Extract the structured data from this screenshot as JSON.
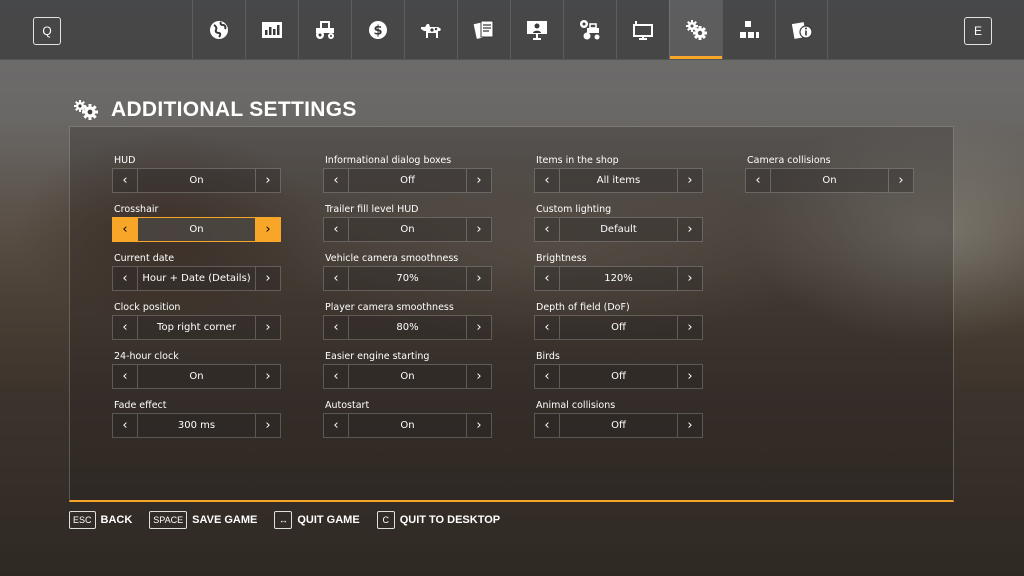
{
  "topbar": {
    "left_key": "Q",
    "right_key": "E",
    "tabs": [
      {
        "icon": "globe-icon"
      },
      {
        "icon": "statistics-icon"
      },
      {
        "icon": "tractor-icon"
      },
      {
        "icon": "money-icon"
      },
      {
        "icon": "cow-icon"
      },
      {
        "icon": "contracts-icon"
      },
      {
        "icon": "tutorial-icon"
      },
      {
        "icon": "vehicle-settings-icon"
      },
      {
        "icon": "monitor-icon"
      },
      {
        "icon": "gears-icon",
        "active": true
      },
      {
        "icon": "production-icon"
      },
      {
        "icon": "help-icon"
      }
    ],
    "accent_color": "#f7a627"
  },
  "page": {
    "title": "ADDITIONAL SETTINGS"
  },
  "columns": [
    [
      {
        "label": "HUD",
        "value": "On"
      },
      {
        "label": "Crosshair",
        "value": "On",
        "selected": true
      },
      {
        "label": "Current date",
        "value": "Hour + Date (Details)"
      },
      {
        "label": "Clock position",
        "value": "Top right corner"
      },
      {
        "label": "24-hour clock",
        "value": "On"
      },
      {
        "label": "Fade effect",
        "value": "300 ms"
      }
    ],
    [
      {
        "label": "Informational dialog boxes",
        "value": "Off"
      },
      {
        "label": "Trailer fill level HUD",
        "value": "On"
      },
      {
        "label": "Vehicle camera smoothness",
        "value": "70%"
      },
      {
        "label": "Player camera smoothness",
        "value": "80%"
      },
      {
        "label": "Easier engine starting",
        "value": "On"
      },
      {
        "label": "Autostart",
        "value": "On"
      }
    ],
    [
      {
        "label": "Items in the shop",
        "value": "All items"
      },
      {
        "label": "Custom lighting",
        "value": "Default"
      },
      {
        "label": "Brightness",
        "value": "120%"
      },
      {
        "label": "Depth of field (DoF)",
        "value": "Off"
      },
      {
        "label": "Birds",
        "value": "Off"
      },
      {
        "label": "Animal collisions",
        "value": "Off"
      }
    ],
    [
      {
        "label": "Camera collisions",
        "value": "On"
      }
    ]
  ],
  "footer": [
    {
      "key": "ESC",
      "label": "BACK"
    },
    {
      "key": "SPACE",
      "label": "SAVE GAME"
    },
    {
      "key": "↔",
      "label": "QUIT GAME"
    },
    {
      "key": "C",
      "label": "QUIT TO DESKTOP"
    }
  ]
}
